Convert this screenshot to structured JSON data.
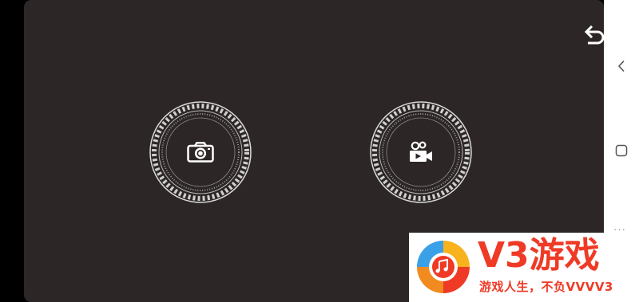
{
  "toolbar": {
    "exit_icon": "undo-arrow-icon"
  },
  "modes": [
    {
      "name": "photo",
      "icon": "camera-icon"
    },
    {
      "name": "video",
      "icon": "video-camera-icon"
    }
  ],
  "navigation_bar": {
    "back_icon": "chevron-left-icon",
    "home_icon": "square-icon",
    "more_label": "···"
  },
  "watermark": {
    "title": "V3游戏",
    "tagline": "游戏人生，不负VVVV3"
  },
  "colors": {
    "panel_background": "#2d2626",
    "screen_background": "#000000",
    "nav_bar_background": "#ffffff",
    "ring_color": "#d9d9d9",
    "watermark_accent": "#ef3a25",
    "watermark_logo_orange": "#f28b1f",
    "watermark_logo_blue": "#3aa0e8"
  }
}
